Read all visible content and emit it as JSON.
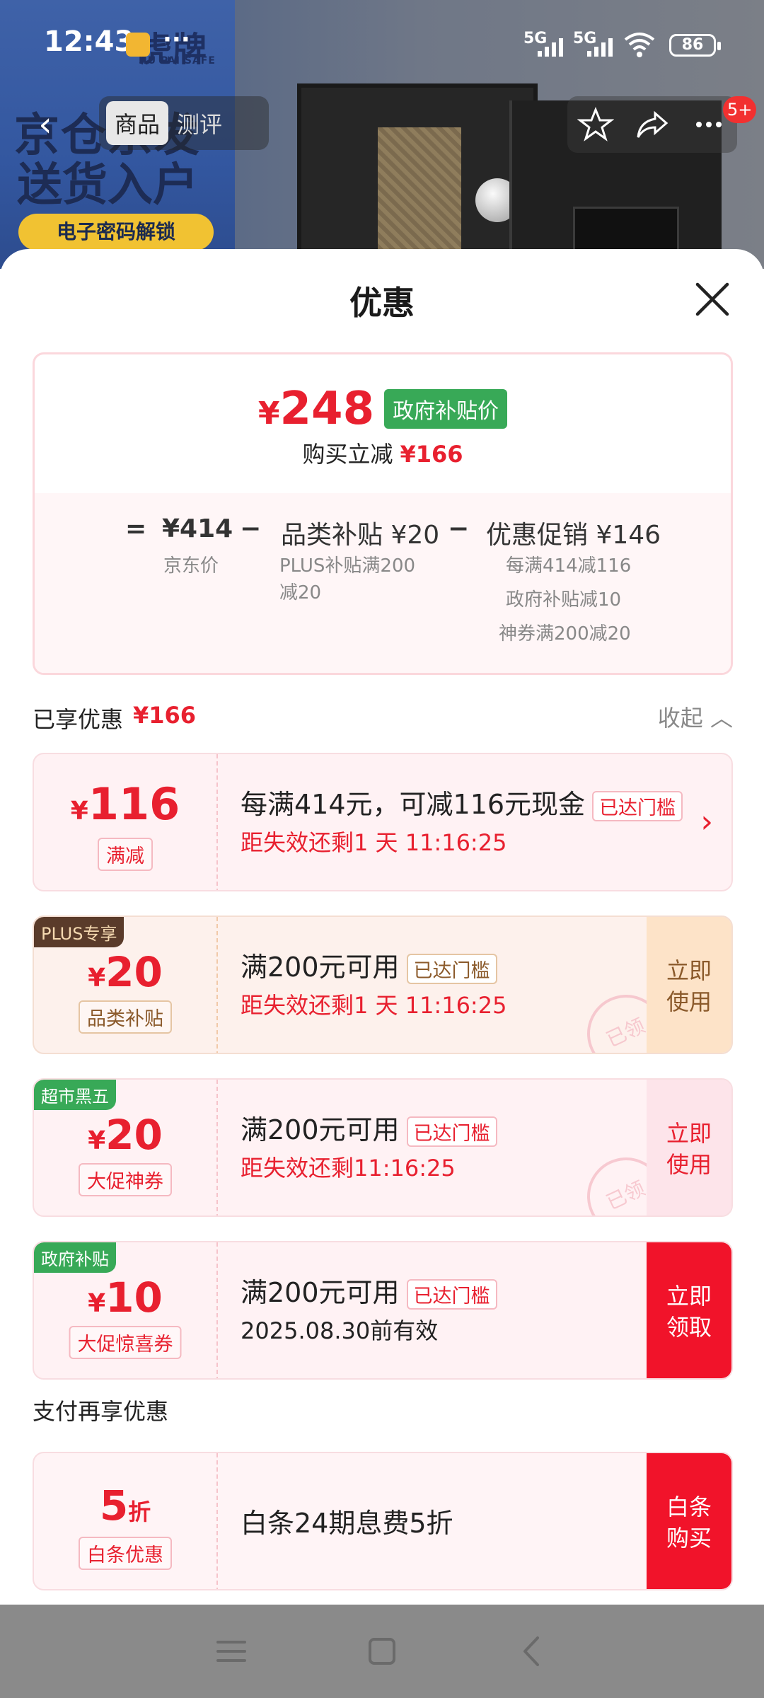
{
  "status_bar": {
    "time": "12:43",
    "more": "···",
    "net1": "5G",
    "net2": "5G",
    "battery": "86"
  },
  "hero_ad": {
    "logo": "虎牌",
    "logo_sub": "HU PAI SAFE",
    "line1": "京仓京发",
    "line2": "送货入户",
    "badge": "电子密码解锁"
  },
  "top_nav": {
    "tabs": [
      "商品",
      "测评"
    ],
    "message_badge": "5+"
  },
  "sheet": {
    "title": "优惠"
  },
  "price_card": {
    "final_price_symbol": "¥",
    "final_price": "248",
    "gov_tag": "政府补贴价",
    "reduce_label": "购买立减",
    "reduce_value": "¥166",
    "eq": "=",
    "jd_price": "¥414",
    "jd_label": "京东价",
    "minus1": "−",
    "category_subsidy": "品类补贴 ¥20",
    "category_note": [
      "PLUS补贴满200",
      "减20"
    ],
    "minus2": "−",
    "promo": "优惠促销 ¥146",
    "promo_notes": [
      "每满414减116",
      "政府补贴减10",
      "神券满200减20"
    ]
  },
  "enjoyed": {
    "label": "已享优惠",
    "value": "¥166",
    "collapse": "收起"
  },
  "coupons": [
    {
      "corner": "",
      "symbol": "¥",
      "amount": "116",
      "type": "满减",
      "title": "每满414元，可减116元现金",
      "tag": "已达门槛",
      "sub": "距失效还剩1 天 11:16:25",
      "action": ""
    },
    {
      "corner": "PLUS专享",
      "symbol": "¥",
      "amount": "20",
      "type": "品类补贴",
      "title": "满200元可用",
      "tag": "已达门槛",
      "sub": "距失效还剩1 天 11:16:25",
      "action": "立即使用",
      "stamp": "已领"
    },
    {
      "corner": "超市黑五",
      "symbol": "¥",
      "amount": "20",
      "type": "大促神券",
      "title": "满200元可用",
      "tag": "已达门槛",
      "sub": "距失效还剩11:16:25",
      "action": "立即使用",
      "stamp": "已领"
    },
    {
      "corner": "政府补贴",
      "symbol": "¥",
      "amount": "10",
      "type": "大促惊喜券",
      "title": "满200元可用",
      "tag": "已达门槛",
      "sub": "2025.08.30前有效",
      "action": "立即领取"
    }
  ],
  "pay_section": {
    "label": "支付再享优惠",
    "amount": "5",
    "unit": "折",
    "type": "白条优惠",
    "title": "白条24期息费5折",
    "action": "白条购买"
  },
  "colors": {
    "accent_red": "#e8202f",
    "gov_green": "#38a957",
    "plus_brown": "#5a3b2a"
  }
}
